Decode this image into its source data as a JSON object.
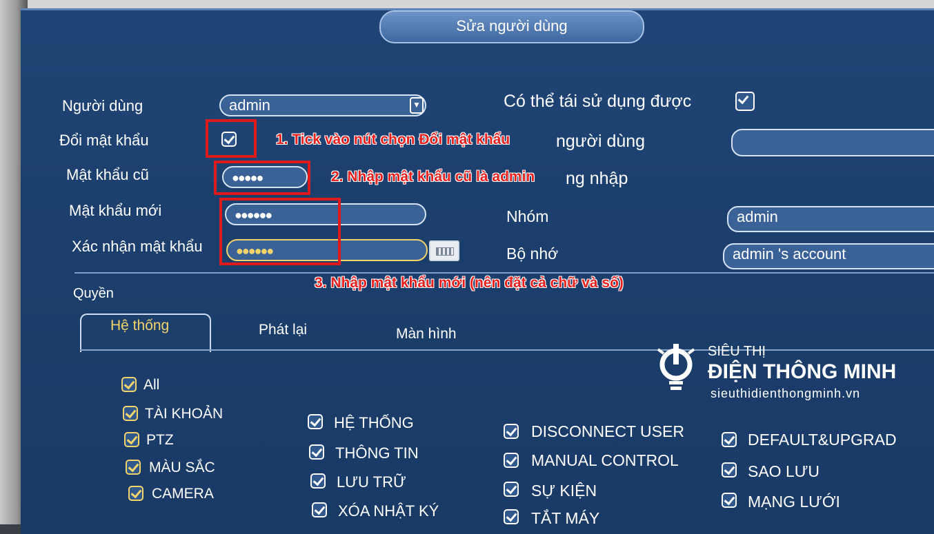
{
  "dialog": {
    "title": "Sửa người dùng"
  },
  "form": {
    "user_label": "Người dùng",
    "user_value": "admin",
    "change_pw_label": "Đổi mật khẩu",
    "old_pw_label": "Mật khẩu cũ",
    "old_pw_value": "●●●●●",
    "new_pw_label": "Mật khẩu mới",
    "new_pw_value": "●●●●●●",
    "confirm_pw_label": "Xác nhận mật khẩu",
    "confirm_pw_value": "●●●●●●",
    "reusable_label": "Có thể tái sử dụng được",
    "username_label": "người dùng",
    "login_label": "ng nhập",
    "group_label": "Nhóm",
    "group_value": "admin",
    "memo_label": "Bộ nhớ",
    "memo_value": "admin 's account"
  },
  "annotations": {
    "step1": "1. Tick vào nút chọn Đổi mật khẩu",
    "step2": "2. Nhập mật khẩu cũ là admin",
    "step3": "3. Nhập mật khẩu mới (nên đặt cả chữ và số)"
  },
  "permissions": {
    "section_label": "Quyền",
    "tabs": [
      "Hệ thống",
      "Phát lại",
      "Màn hình"
    ],
    "col1": [
      "All",
      "TÀI KHOẢN",
      "PTZ",
      "MÀU SẮC",
      "CAMERA"
    ],
    "col2": [
      "HỆ THỐNG",
      "THÔNG TIN",
      "LƯU TRỮ",
      "XÓA NHẬT KÝ"
    ],
    "col3": [
      "DISCONNECT USER",
      "MANUAL CONTROL",
      "SỰ KIỆN",
      "TẮT MÁY"
    ],
    "col4": [
      "DEFAULT&UPGRAD",
      "SAO LƯU",
      "MẠNG LƯỚI"
    ]
  },
  "watermark": {
    "line1": "SIÊU THỊ",
    "line2": "ĐIỆN THÔNG MINH",
    "url": "sieuthidienthongminh.vn"
  },
  "colors": {
    "accent": "#f2d46b",
    "annotation": "#e01a1a",
    "panel": "#1c3f6d"
  }
}
